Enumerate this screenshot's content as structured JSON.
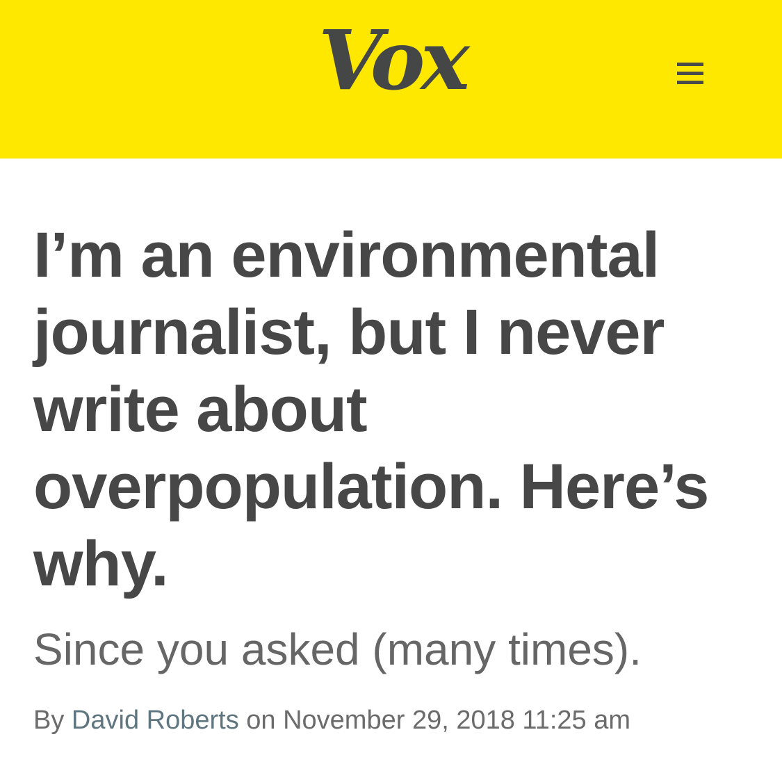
{
  "header": {
    "logo_text": "Vox",
    "background": "#ffe800",
    "menu_icon": "hamburger-menu-icon"
  },
  "article": {
    "headline": "I’m an environmental journalist, but I never write about overpopulation. Here’s why.",
    "dek": "Since you asked (many times).",
    "byline": {
      "prefix": "By",
      "author": "David Roberts",
      "on": "on",
      "date": "November 29, 2018 11:25 am"
    }
  },
  "colors": {
    "brand_yellow": "#ffe800",
    "text_dark": "#474747",
    "text_gray": "#666666",
    "author_link": "#5f7681"
  }
}
